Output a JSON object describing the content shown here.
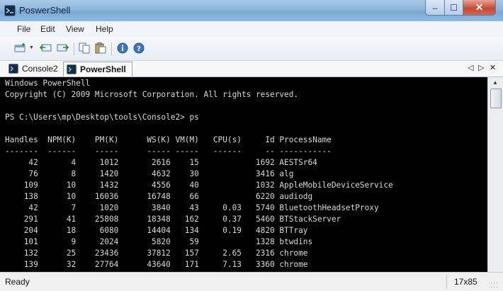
{
  "window": {
    "title": "PoswerShell"
  },
  "menu": {
    "items": [
      "File",
      "Edit",
      "View",
      "Help"
    ]
  },
  "tabs": [
    {
      "label": "Console2",
      "active": false
    },
    {
      "label": "PowerShell",
      "active": true
    }
  ],
  "console": {
    "lines": [
      "Windows PowerShell",
      "Copyright (C) 2009 Microsoft Corporation. All rights reserved.",
      "",
      "PS C:\\Users\\mp\\Desktop\\tools\\Console2> ps",
      "",
      "Handles  NPM(K)    PM(K)      WS(K) VM(M)   CPU(s)     Id ProcessName",
      "-------  ------    -----      ----- -----   ------     -- -----------",
      "     42       4     1012       2616    15            1692 AESTSr64",
      "     76       8     1420       4632    30            3416 alg",
      "    109      10     1432       4556    40            1032 AppleMobileDeviceService",
      "    138      10    16036      16748    66            6220 audiodg",
      "     42       7     1020       3840    43     0.03   5740 BluetoothHeadsetProxy",
      "    291      41    25808      18348   162     0.37   5460 BTStackServer",
      "    204      18     6080      14404   134     0.19   4820 BTTray",
      "    101       9     2024       5820    59            1328 btwdins",
      "    132      25    23436      37812   157     2.65   2316 chrome",
      "    139      32    27764      43640   171     7.13   3360 chrome"
    ]
  },
  "status": {
    "text": "Ready",
    "size": "17x85"
  },
  "colors": {
    "console_bg": "#000000",
    "console_fg": "#d8d8d8",
    "titlebar": "#8cb7dd"
  }
}
